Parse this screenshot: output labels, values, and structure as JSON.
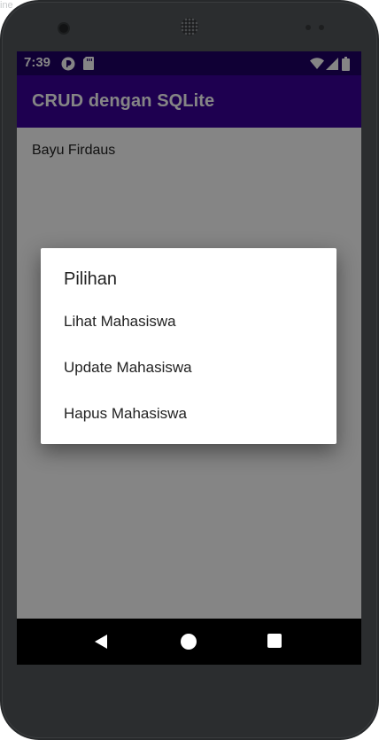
{
  "device": {
    "corner_text": "ine"
  },
  "status_bar": {
    "time": "7:39",
    "icons": [
      "app-notification-icon",
      "sd-card-icon",
      "wifi-icon",
      "signal-icon",
      "battery-icon"
    ]
  },
  "app_bar": {
    "title": "CRUD dengan SQLite",
    "color": "#3a0099"
  },
  "list": {
    "items": [
      "Bayu Firdaus"
    ]
  },
  "dialog": {
    "title": "Pilihan",
    "options": [
      "Lihat Mahasiswa",
      "Update Mahasiswa",
      "Hapus Mahasiswa"
    ]
  },
  "fab": {
    "icon": "plus-icon",
    "label": "+",
    "color": "#02b4a0"
  },
  "nav_bar": {
    "buttons": [
      "back-icon",
      "home-icon",
      "recents-icon"
    ]
  }
}
